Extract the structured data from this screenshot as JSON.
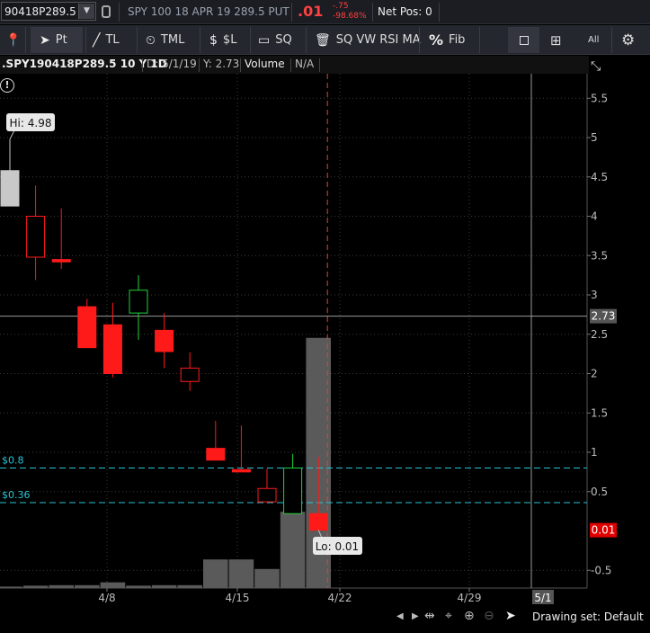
{
  "symbol_bar": {
    "symbol": "90418P289.5",
    "description": "SPY 100 18 APR 19 289.5 PUT",
    "last_price": ".01",
    "change": "-.75",
    "change_pct": "-98.68%",
    "net_pos": "Net Pos: 0"
  },
  "toolbar": {
    "pt_label": "Pt",
    "tl_label": "TL",
    "tml_label": "TML",
    "sl_label": "$L",
    "sq_label": "SQ",
    "sqvw_label": "SQ VW RSI MA",
    "fib_label": "Fib",
    "all_label": "All"
  },
  "chart_header": {
    "symbol": ".SPY190418P289.5 10 Y 1D",
    "date": "D: 5/1/19",
    "y": "Y: 2.73",
    "volume_label": "Volume",
    "volume_value": "N/A"
  },
  "chart_data": {
    "type": "candlestick",
    "ylim": [
      -0.65,
      5.75
    ],
    "y_ticks": [
      "5.5",
      "5",
      "4.5",
      "4",
      "3.5",
      "3",
      "2.5",
      "2",
      "1.5",
      "1",
      "0.5",
      "-0.5"
    ],
    "x_ticks": [
      "4/8",
      "4/15",
      "4/22",
      "4/29"
    ],
    "cursor_x_label": "5/1",
    "cursor_y_value": 2.73,
    "cursor_y_label": "2.73",
    "last_price_label": "0.01",
    "last_price_value": 0.01,
    "hi_label": "Hi: 4.98",
    "lo_label": "Lo: 0.01",
    "price_lines": [
      {
        "label": "$0.8",
        "value": 0.8
      },
      {
        "label": "$0.36",
        "value": 0.36
      }
    ],
    "colors": {
      "up": "#1fd23a",
      "down": "#ff1a1a",
      "gray": "#c8c8c8",
      "volume": "#5a5a5a",
      "price_line": "#29c5d6",
      "cursor": "#e04040"
    },
    "candles": [
      {
        "date": "4/3",
        "open": 4.58,
        "high": 4.98,
        "low": 4.13,
        "close": 4.13,
        "style": "gray"
      },
      {
        "date": "4/4",
        "open": 4.0,
        "high": 4.39,
        "low": 3.19,
        "close": 3.48,
        "style": "down-hollow"
      },
      {
        "date": "4/5",
        "open": 3.45,
        "high": 4.1,
        "low": 3.33,
        "close": 3.42,
        "style": "down-filled"
      },
      {
        "date": "4/8",
        "open": 2.85,
        "high": 2.95,
        "low": 2.35,
        "close": 2.33,
        "style": "down-filled"
      },
      {
        "date": "4/9",
        "open": 2.62,
        "high": 2.9,
        "low": 1.95,
        "close": 2.0,
        "style": "down-filled"
      },
      {
        "date": "4/10",
        "open": 2.77,
        "high": 3.25,
        "low": 2.43,
        "close": 3.06,
        "style": "up-hollow"
      },
      {
        "date": "4/11",
        "open": 2.55,
        "high": 2.77,
        "low": 2.07,
        "close": 2.28,
        "style": "down-filled"
      },
      {
        "date": "4/12",
        "open": 2.07,
        "high": 2.27,
        "low": 1.78,
        "close": 1.9,
        "style": "down-hollow"
      },
      {
        "date": "4/15",
        "open": 1.05,
        "high": 1.4,
        "low": 0.9,
        "close": 0.9,
        "style": "down-filled"
      },
      {
        "date": "4/16",
        "open": 0.78,
        "high": 1.34,
        "low": 0.75,
        "close": 0.75,
        "style": "down-filled"
      },
      {
        "date": "4/17",
        "open": 0.54,
        "high": 0.79,
        "low": 0.37,
        "close": 0.37,
        "style": "down-hollow"
      },
      {
        "date": "4/18",
        "open": 0.22,
        "high": 0.98,
        "low": 0.22,
        "close": 0.8,
        "style": "up-hollow"
      },
      {
        "date": "4/19",
        "open": 0.22,
        "high": 0.94,
        "low": 0.01,
        "close": 0.01,
        "style": "down-filled"
      }
    ],
    "volume_relative": [
      0.03,
      0.05,
      0.06,
      0.06,
      0.12,
      0.05,
      0.06,
      0.06,
      0.6,
      0.6,
      0.4,
      1.6,
      5.25
    ]
  },
  "bottom_bar": {
    "drawing_set": "Drawing set: Default"
  }
}
